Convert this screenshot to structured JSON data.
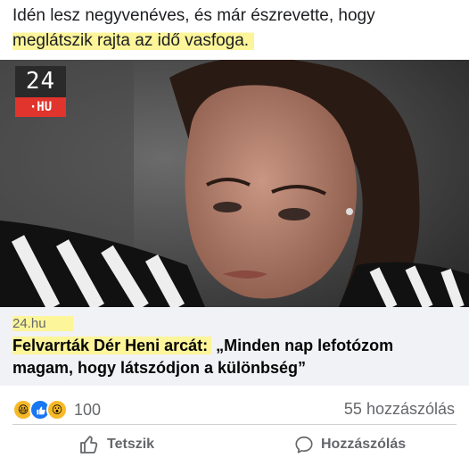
{
  "post": {
    "caption_line1": "Idén lesz negyvenéves, és már észrevette, hogy",
    "caption_line2": "meglátszik rajta az idő vasfoga."
  },
  "image": {
    "logo_top": "24",
    "logo_bottom": "·HU"
  },
  "link": {
    "domain": "24.hu",
    "headline_part1": "Felvarrták Dér Heni arcát:",
    "headline_part2": " „Minden nap lefotózom magam, hogy látszódjon a különbség”"
  },
  "stats": {
    "reaction_icons": [
      "haha-icon",
      "like-icon",
      "wow-icon"
    ],
    "reaction_count": "100",
    "comment_count": "55 hozzászólás"
  },
  "actions": {
    "like_label": "Tetszik",
    "comment_label": "Hozzászólás"
  },
  "colors": {
    "highlight": "#fcf59a",
    "link_box_bg": "#f0f2f5",
    "secondary_text": "#65676b",
    "logo_red": "#e1342c"
  }
}
